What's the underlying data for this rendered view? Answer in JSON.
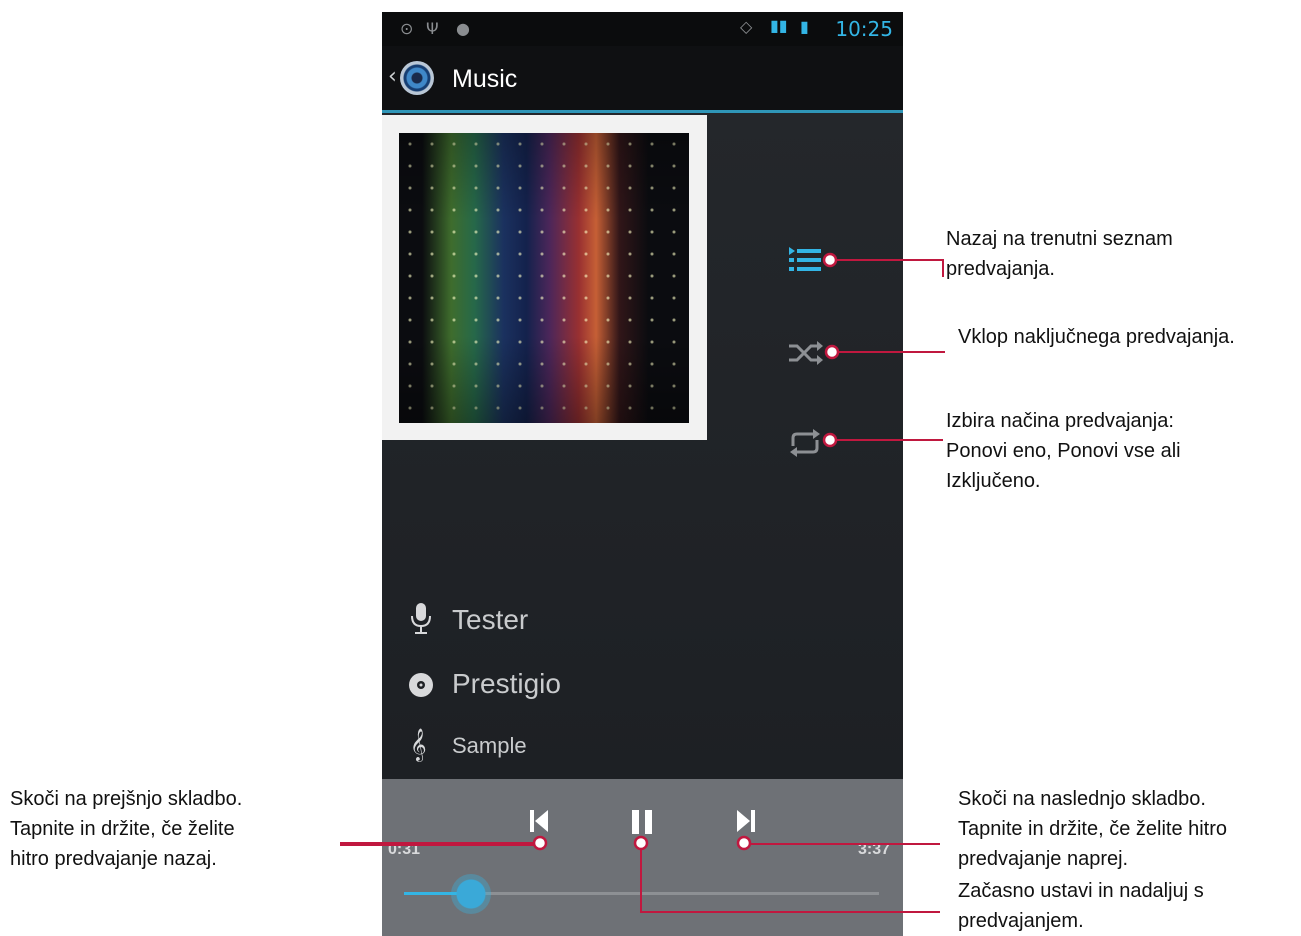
{
  "status_bar": {
    "time": "10:25"
  },
  "app_bar": {
    "title": "Music"
  },
  "track": {
    "artist": "Tester",
    "album": "Prestigio",
    "song": "Sample"
  },
  "player": {
    "elapsed": "0:31",
    "duration": "3:37",
    "progress_fraction": 0.14
  },
  "callouts": {
    "playlist": [
      "Nazaj na trenutni seznam",
      "predvajanja."
    ],
    "shuffle": [
      "Vklop naključnega predvajanja."
    ],
    "repeat": [
      "Izbira načina predvajanja:",
      "Ponovi eno, Ponovi vse ali",
      "Izključeno."
    ],
    "previous": [
      "Skoči na prejšnjo skladbo.",
      "Tapnite in držite, če želite",
      "hitro predvajanje nazaj."
    ],
    "next": [
      "Skoči na naslednjo skladbo.",
      "Tapnite in držite, če želite  hitro",
      "predvajanje naprej."
    ],
    "pause": [
      "Začasno ustavi in nadaljuj s",
      "predvajanjem."
    ]
  },
  "colors": {
    "accent": "#33b5e5",
    "callout_line": "#c0183f"
  },
  "icons": [
    "back-chevron-icon",
    "music-app-icon",
    "now-playing-list-icon",
    "shuffle-icon",
    "repeat-icon",
    "microphone-icon",
    "disc-icon",
    "treble-clef-icon",
    "previous-track-icon",
    "pause-icon",
    "next-track-icon"
  ]
}
